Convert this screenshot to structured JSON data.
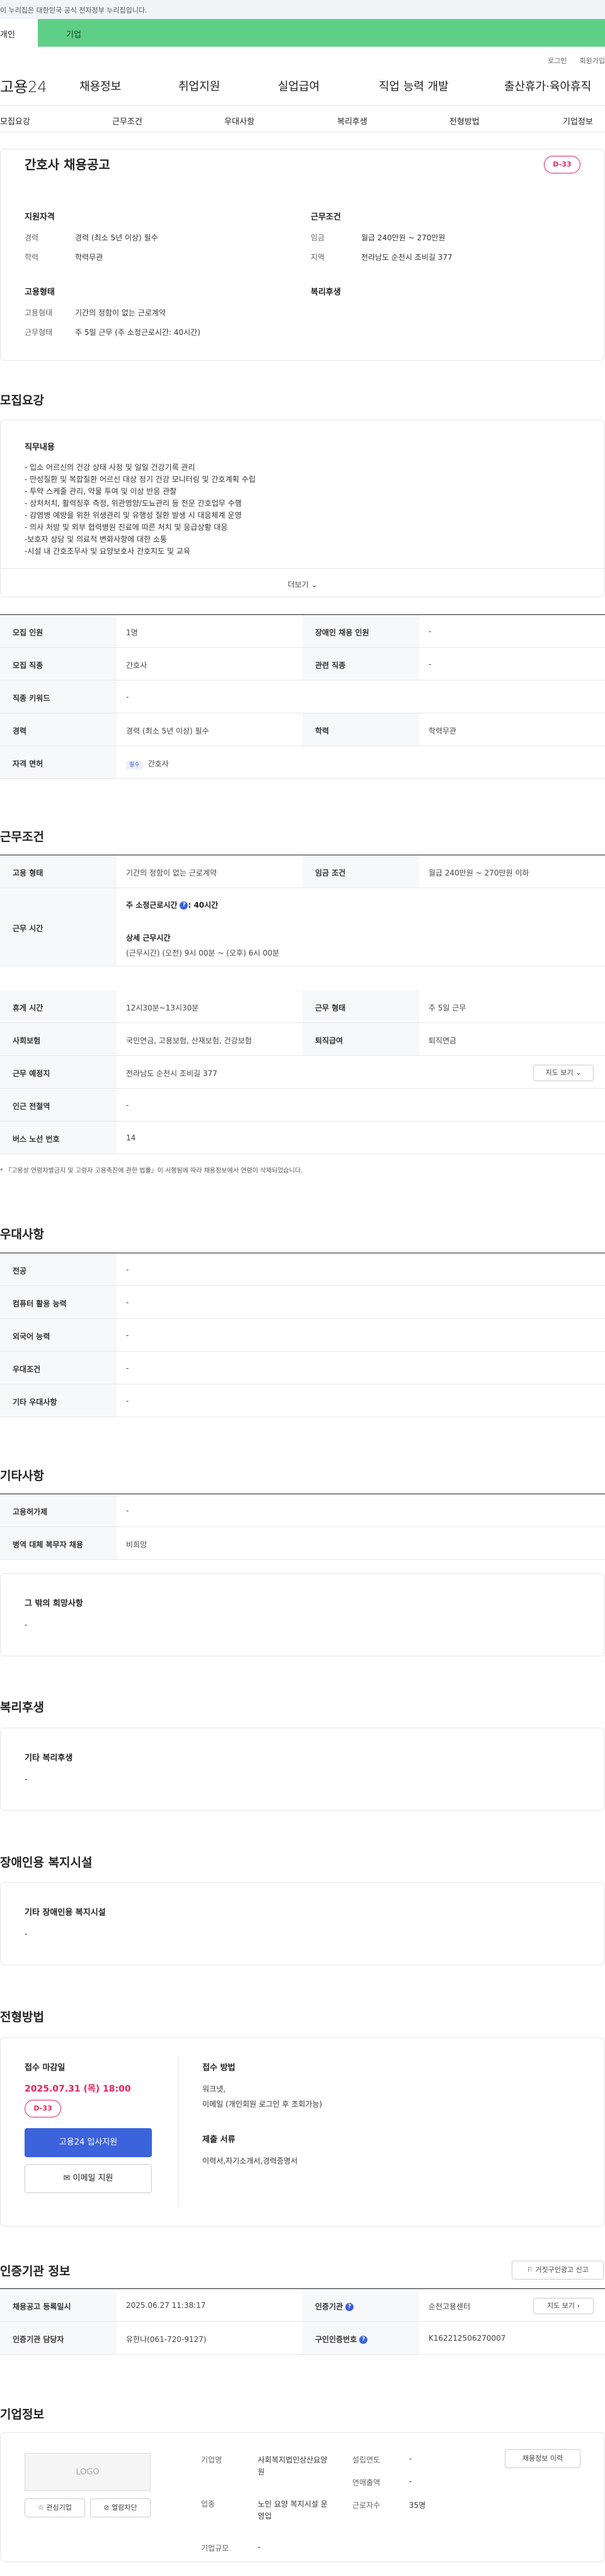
{
  "gov_banner": "이 누리집은 대한민국 공식 전자정부 누리집입니다.",
  "tabs": {
    "personal": "개인",
    "company": "기업"
  },
  "util": {
    "login": "로그인",
    "join": "회원가입"
  },
  "gnb": {
    "logo": "고용24",
    "items": [
      "채용정보",
      "취업지원",
      "실업급여",
      "직업 능력 개발",
      "출산휴가·육아휴직"
    ]
  },
  "lnb": [
    "모집요강",
    "근무조건",
    "우대사항",
    "복리후생",
    "전형방법",
    "기업정보"
  ],
  "summary": {
    "title": "간호사 채용공고",
    "dday": "D-33",
    "qual_head": "지원자격",
    "career_label": "경력",
    "career": "경력 (최소 5년 이상) 필수",
    "edu_label": "학력",
    "edu": "학력무관",
    "cond_head": "근무조건",
    "wage_label": "임금",
    "wage": "월급 240만원 ~ 270만원",
    "region_label": "지역",
    "region": "전라남도 순천시 조비길 377",
    "emp_head": "고용형태",
    "emp_type_label": "고용형태",
    "emp_type": "기간의 정함이 없는 근로계약",
    "work_label": "근무형태",
    "work": "주 5일 근무 (주 소정근로시간: 40시간)",
    "welfare_head": "복리후생"
  },
  "recruit": {
    "title": "모집요강",
    "duty_head": "직무내용",
    "duties": [
      "- 입소 어르신의 건강 상태 사정 및 일일 건강기록 관리",
      "- 만성질환 및 복합질환 어르신 대상 정기 건강 모니터링 및 간호계획 수립",
      "- 투약 스케줄 관리, 약물 투여 및 이상 반응 관찰",
      "- 상처처치, 활력징후 측정, 위관영양/도뇨관리 등 전문 간호업무 수행",
      "- 감염병 예방을 위한 위생관리 및 유행성 질환 발생 시 대응체계 운영",
      "- 의사 처방 및 외부 협력병원 진료에 따른 처치 및 응급상황 대응",
      "-보호자 상담 및 의료적 변화사항에 대한 소통",
      "-시설 내 간호조무사 및 요양보호사 간호지도 및 교육"
    ],
    "more": "더보기",
    "rows": [
      {
        "k": "모집 인원",
        "v": "1명",
        "k2": "장애인 채용 인원",
        "v2": "-"
      },
      {
        "k": "모집 직종",
        "v": "간호사",
        "k2": "관련 직종",
        "v2": "-"
      },
      {
        "k": "직종 키워드",
        "v": "-"
      },
      {
        "k": "경력",
        "v": "경력 (최소 5년 이상) 필수",
        "k2": "학력",
        "v2": "학력무관"
      },
      {
        "k": "자격 면허",
        "badge": "필수",
        "v": "간호사"
      }
    ]
  },
  "cond": {
    "title": "근무조건",
    "emp_k": "고용 형태",
    "emp_v": "기간의 정함이 없는 근로계약",
    "wage_k": "임금 조건",
    "wage_v": "월급 240만원 ~ 270만원 이하",
    "time_k": "근무 시간",
    "time_main": "주 소정근로시간",
    "time_val": ": 40시간",
    "time_detail_head": "상세 근무시간",
    "time_detail": "(근무시간) (오전) 9시 00분 ~ (오후) 6시 00분",
    "rest_k": "휴게 시간",
    "rest_v": "12시30분~13시30분",
    "form_k": "근무 형태",
    "form_v": "주 5일 근무",
    "ins_k": "사회보험",
    "ins_v": "국민연금, 고용보험, 산재보험, 건강보험",
    "ret_k": "퇴직급여",
    "ret_v": "퇴직연금",
    "place_k": "근무 예정지",
    "place_v": "전라남도 순천시 조비길 377",
    "map": "지도 보기",
    "sub_k": "인근 전철역",
    "sub_v": "-",
    "bus_k": "버스 노선 번호",
    "bus_v": "14",
    "note": "* 『고용상 연령차별금지 및 고령자 고용촉진에 관한 법률』이 시행됨에 따라 채용정보에서 연령이 삭제되었습니다."
  },
  "pref": {
    "title": "우대사항",
    "rows": [
      {
        "k": "전공",
        "v": "-"
      },
      {
        "k": "컴퓨터 활용 능력",
        "v": "-"
      },
      {
        "k": "외국어 능력",
        "v": "-"
      },
      {
        "k": "우대조건",
        "v": "-"
      },
      {
        "k": "기타 우대사항",
        "v": "-"
      }
    ]
  },
  "etc": {
    "title": "기타사항",
    "rows": [
      {
        "k": "고용허가제",
        "v": "-"
      },
      {
        "k": "병역 대체 복무자 채용",
        "v": "비희망"
      }
    ],
    "other_head": "그 밖의 희망사항",
    "other_val": "-"
  },
  "welfare": {
    "title": "복리후생",
    "head": "기타 복리후생",
    "val": "-"
  },
  "disab": {
    "title": "장애인용 복지시설",
    "head": "기타 장애인용 복지시설",
    "val": "-"
  },
  "selection": {
    "title": "전형방법",
    "deadline_head": "접수 마감일",
    "deadline": "2025.07.31 (목) 18:00",
    "dday": "D-33",
    "apply": "고용24 입사지원",
    "email": "이메일 지원",
    "method_head": "접수 방법",
    "methods": [
      "워크넷,",
      "이메일 (개인회원 로그인 후 조회가능)"
    ],
    "docs_head": "제출 서류",
    "docs": "이력서,자기소개서,경력증명서"
  },
  "cert": {
    "title": "인증기관 정보",
    "report": "거짓구인광고 신고",
    "rows": [
      {
        "k": "채용공고 등록일시",
        "v": "2025.06.27 11:38:17",
        "k2": "인증기관",
        "v2": "순천고용센터"
      },
      {
        "k": "인증기관 담당자",
        "v": "유한나(061-720-9127)",
        "k2": "구인인증번호",
        "v2": "K162212506270007"
      }
    ],
    "map": "지도 보기"
  },
  "company": {
    "title": "기업정보",
    "logo": "LOGO",
    "fav": "관심기업",
    "block": "열람차단",
    "history": "채용정보 이력",
    "name_k": "기업명",
    "name_v": "사회복지법인상산요양원",
    "found_k": "설립연도",
    "found_v": "-",
    "industry_k": "업종",
    "industry_v": "노인 요양 복지시설 운영업",
    "sales_k": "연매출액",
    "sales_v": "-",
    "emp_k": "근로자수",
    "emp_v": "35명",
    "size_k": "기업규모",
    "size_v": "-"
  }
}
